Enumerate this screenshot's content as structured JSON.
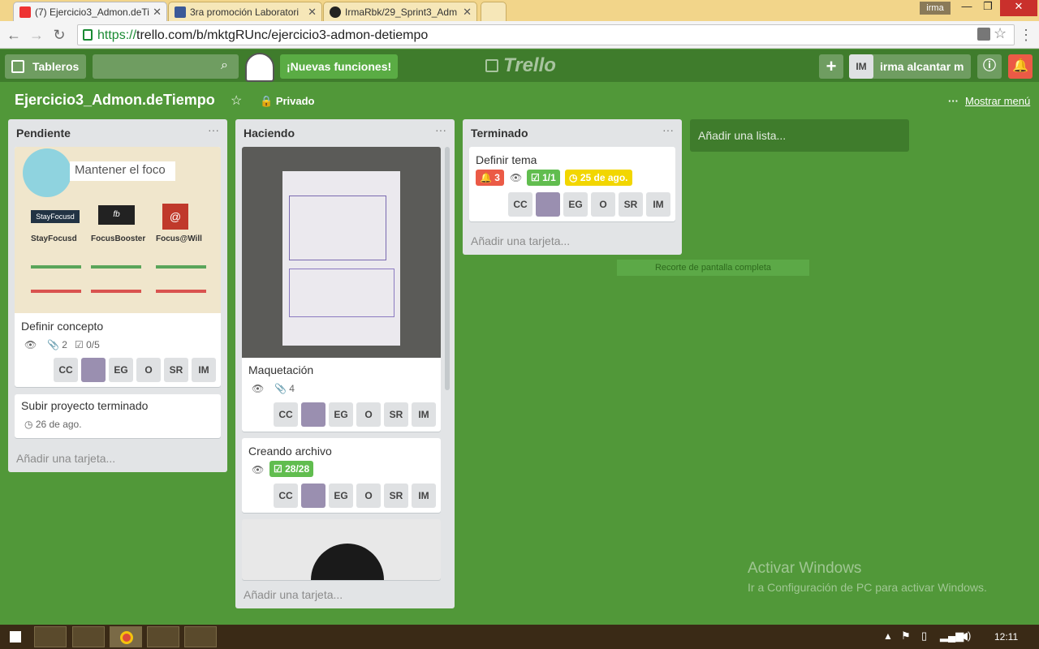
{
  "browser": {
    "tabs": [
      {
        "label": "(7) Ejercicio3_Admon.deTi",
        "icon": "trello-icon",
        "active": true
      },
      {
        "label": "3ra promoción Laboratori",
        "icon": "facebook-icon",
        "active": false
      },
      {
        "label": "IrmaRbk/29_Sprint3_Adm",
        "icon": "github-icon",
        "active": false
      }
    ],
    "user_chip": "irma",
    "url_https": "https://",
    "url_rest": "trello.com/b/mktgRUnc/ejercicio3-admon-detiempo"
  },
  "header": {
    "boards_label": "Tableros",
    "new_features_label": "¡Nuevas funciones!",
    "logo_text": "Trello",
    "user_initials": "IM",
    "user_name": "irma alcantar m"
  },
  "board": {
    "title": "Ejercicio3_Admon.deTiempo",
    "visibility": "Privado",
    "show_menu": "Mostrar menú",
    "add_list": "Añadir una lista...",
    "lists": [
      {
        "title": "Pendiente",
        "add_card": "Añadir una tarjeta...",
        "cards": [
          {
            "cover": {
              "heading": "Mantener el foco",
              "apps": [
                "StayFocusd",
                "FocusBooster",
                "Focus@Will"
              ],
              "brands": [
                "StayFocusd",
                "fb",
                "@"
              ]
            },
            "title": "Definir concepto",
            "attachments": "2",
            "checklist": "0/5"
          },
          {
            "title": "Subir proyecto terminado",
            "due": "26 de ago."
          }
        ]
      },
      {
        "title": "Haciendo",
        "add_card": "Añadir una tarjeta...",
        "cards": [
          {
            "title": "Maquetación",
            "attachments": "4"
          },
          {
            "title": "Creando archivo",
            "checklist": "28/28"
          }
        ]
      },
      {
        "title": "Terminado",
        "add_card": "Añadir una tarjeta...",
        "cards": [
          {
            "title": "Definir tema",
            "notifications": "3",
            "checklist": "1/1",
            "due": "25 de ago."
          }
        ]
      }
    ],
    "members": [
      "CC",
      "EG",
      "O",
      "SR",
      "IM"
    ]
  },
  "overlay": {
    "screenshot_hint": "Recorte de pantalla completa",
    "watermark_title": "Activar Windows",
    "watermark_sub": "Ir a Configuración de PC para activar Windows."
  },
  "taskbar": {
    "time": "12:11"
  },
  "colors": {
    "board_bg": "#519839",
    "header_bg": "#3f7c2c",
    "label_red": "#eb5a46",
    "label_green": "#61bd4f",
    "label_yellow": "#f2d600"
  }
}
